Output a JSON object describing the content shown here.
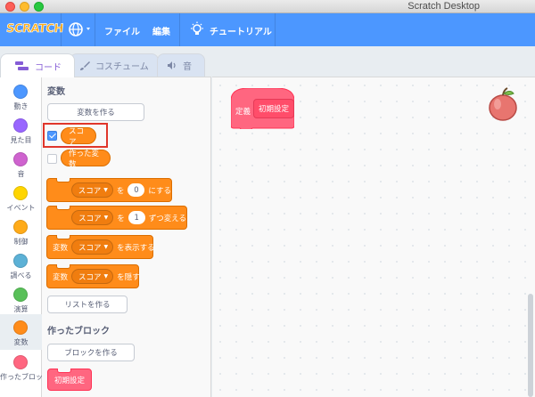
{
  "window": {
    "title": "Scratch Desktop"
  },
  "menubar": {
    "logo": "SCRATCH",
    "file": "ファイル",
    "edit": "編集",
    "tutorials": "チュートリアル"
  },
  "tabs": [
    {
      "label": "コード",
      "active": true
    },
    {
      "label": "コスチューム",
      "active": false
    },
    {
      "label": "音",
      "active": false
    }
  ],
  "categories": [
    {
      "label": "動き",
      "color": "#4c97ff"
    },
    {
      "label": "見た目",
      "color": "#9966ff"
    },
    {
      "label": "音",
      "color": "#cf63cf"
    },
    {
      "label": "イベント",
      "color": "#ffd500"
    },
    {
      "label": "制御",
      "color": "#ffab19"
    },
    {
      "label": "調べる",
      "color": "#5cb1d6"
    },
    {
      "label": "演算",
      "color": "#59c059"
    },
    {
      "label": "変数",
      "color": "#ff8c1a",
      "selected": true
    },
    {
      "label": "作ったブロック",
      "color": "#ff6680"
    }
  ],
  "palette": {
    "variables_title": "変数",
    "make_variable": "変数を作る",
    "variables": [
      {
        "name": "スコア",
        "checked": true
      },
      {
        "name": "作った変数",
        "checked": false
      }
    ],
    "blocks": {
      "set": {
        "var": "スコア",
        "to": "を",
        "value": "0",
        "suffix": "にする"
      },
      "change": {
        "var": "スコア",
        "by": "を",
        "value": "1",
        "suffix": "ずつ変える"
      },
      "show": {
        "prefix": "変数",
        "var": "スコア",
        "suffix": "を表示する"
      },
      "hide": {
        "prefix": "変数",
        "var": "スコア",
        "suffix": "を隠す"
      }
    },
    "make_list": "リストを作る",
    "my_blocks_title": "作ったブロック",
    "make_block": "ブロックを作る",
    "custom_block": "初期設定"
  },
  "script": {
    "define_label": "定義",
    "define_name": "初期設定"
  }
}
